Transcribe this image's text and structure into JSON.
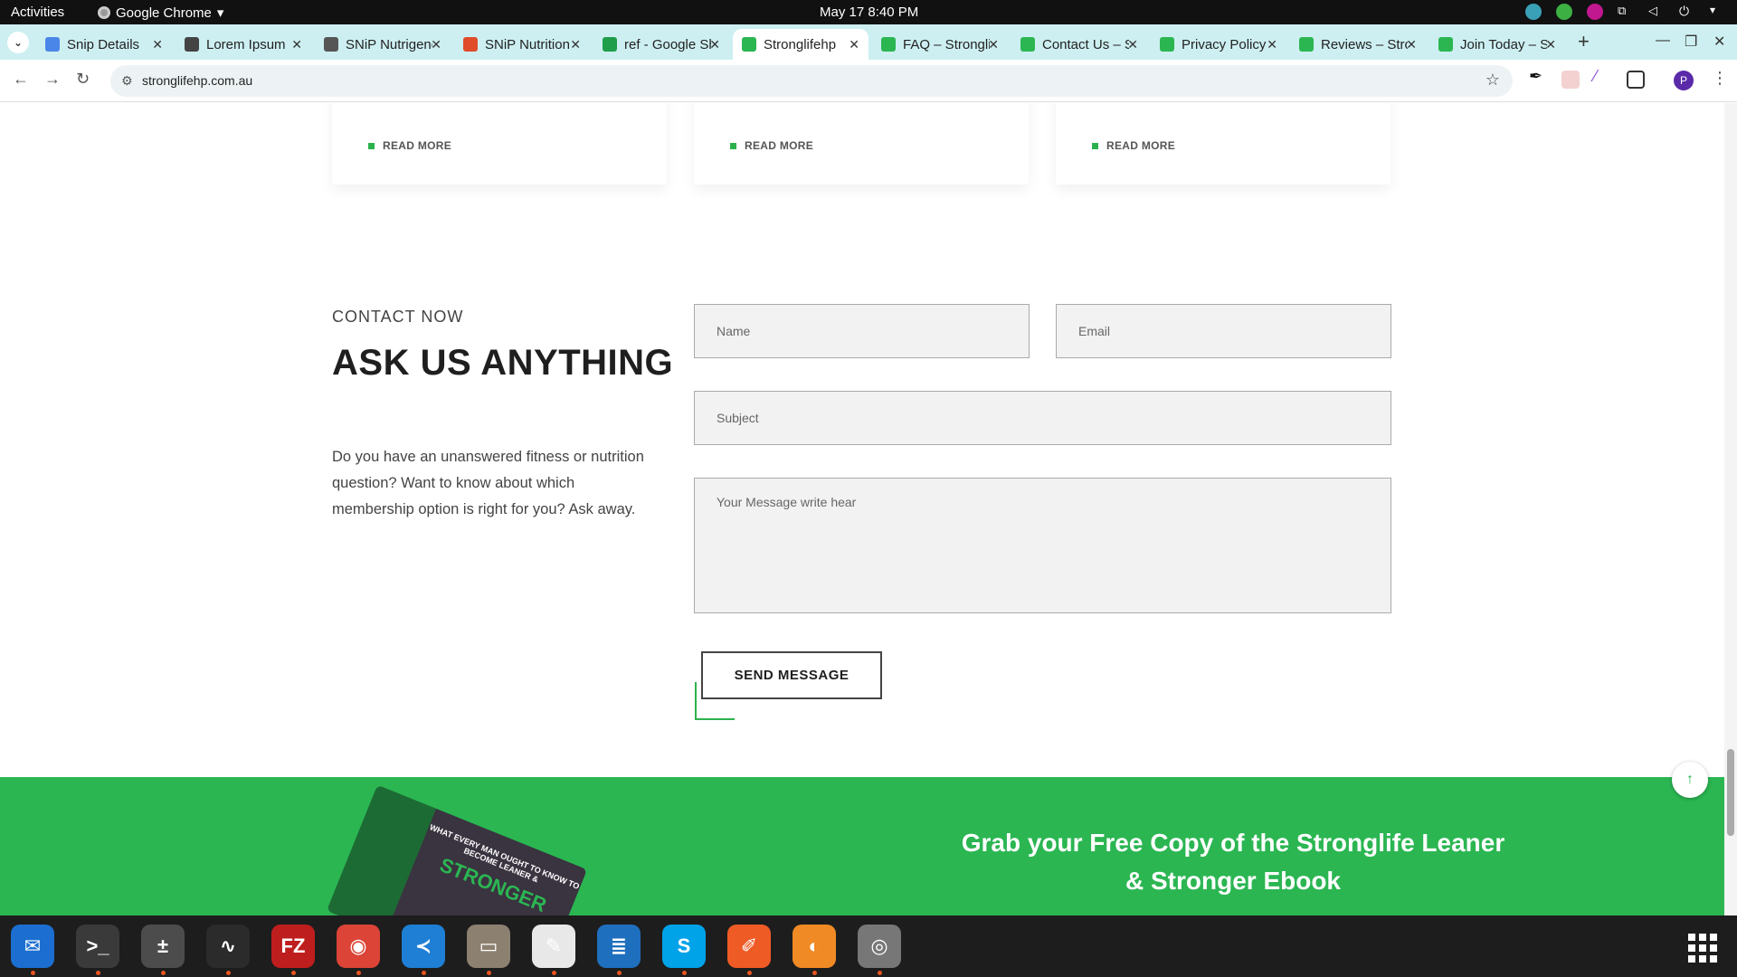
{
  "system": {
    "activities": "Activities",
    "app_name": "Google Chrome",
    "clock": "May 17  8:40 PM"
  },
  "tabs": [
    {
      "title": "Snip Details",
      "color": "#4a86e8"
    },
    {
      "title": "Lorem Ipsum",
      "color": "#444444"
    },
    {
      "title": "SNiP Nutrigenomics",
      "color": "#555555"
    },
    {
      "title": "SNiP Nutrition",
      "color": "#e04b2a"
    },
    {
      "title": "ref - Google Sheets",
      "color": "#1e9e4b"
    },
    {
      "title": "Stronglifehp",
      "color": "#2bb652"
    },
    {
      "title": "FAQ – Stronglife",
      "color": "#2bb652"
    },
    {
      "title": "Contact Us – Stronglife",
      "color": "#2bb652"
    },
    {
      "title": "Privacy Policy",
      "color": "#2bb652"
    },
    {
      "title": "Reviews – Stronglife",
      "color": "#2bb652"
    },
    {
      "title": "Join Today – Stronglife",
      "color": "#2bb652"
    }
  ],
  "active_tab_index": 5,
  "address_bar": {
    "url": "stronglifehp.com.au"
  },
  "cards": [
    {
      "read_more": "READ MORE"
    },
    {
      "read_more": "READ MORE"
    },
    {
      "read_more": "READ MORE"
    }
  ],
  "contact": {
    "eyebrow": "CONTACT NOW",
    "heading": "ASK US ANYTHING",
    "intro": "Do you have an unanswered fitness or nutrition question? Want to know about which membership option is right for you? Ask away.",
    "name_placeholder": "Name",
    "email_placeholder": "Email",
    "subject_placeholder": "Subject",
    "message_placeholder": "Your Message write hear",
    "send_label": "SEND MESSAGE"
  },
  "promo": {
    "title": "Grab your Free Copy of the Stronglife Leaner & Stronger Ebook",
    "book_tagline": "WHAT EVERY MAN OUGHT TO KNOW TO BECOME LEANER &",
    "book_title": "STRONGER"
  },
  "profile_initial": "P",
  "colors": {
    "brand_green": "#2bb652",
    "tab_strip": "#cdeff1"
  },
  "dock_apps": [
    {
      "name": "thunderbird-icon",
      "color": "#1c6fd1",
      "glyph": "✉"
    },
    {
      "name": "terminal-icon",
      "color": "#3a3a3a",
      "glyph": ">_"
    },
    {
      "name": "calculator-icon",
      "color": "#4c4c4c",
      "glyph": "±"
    },
    {
      "name": "system-monitor-icon",
      "color": "#2b2b2b",
      "glyph": "∿"
    },
    {
      "name": "filezilla-icon",
      "color": "#bf1e1e",
      "glyph": "FZ"
    },
    {
      "name": "chrome-icon",
      "color": "#db4437",
      "glyph": "◉"
    },
    {
      "name": "vscode-icon",
      "color": "#1e7fd4",
      "glyph": "≺"
    },
    {
      "name": "files-icon",
      "color": "#8c8070",
      "glyph": "▭"
    },
    {
      "name": "text-editor-icon",
      "color": "#e8e8e8",
      "glyph": "✎"
    },
    {
      "name": "libreoffice-writer-icon",
      "color": "#1f6fbf",
      "glyph": "≣"
    },
    {
      "name": "skype-icon",
      "color": "#00a2e8",
      "glyph": "S"
    },
    {
      "name": "postman-icon",
      "color": "#ef5b25",
      "glyph": "✐"
    },
    {
      "name": "blender-like-icon",
      "color": "#f08a24",
      "glyph": "◐"
    },
    {
      "name": "disk-icon",
      "color": "#777777",
      "glyph": "◎"
    }
  ]
}
